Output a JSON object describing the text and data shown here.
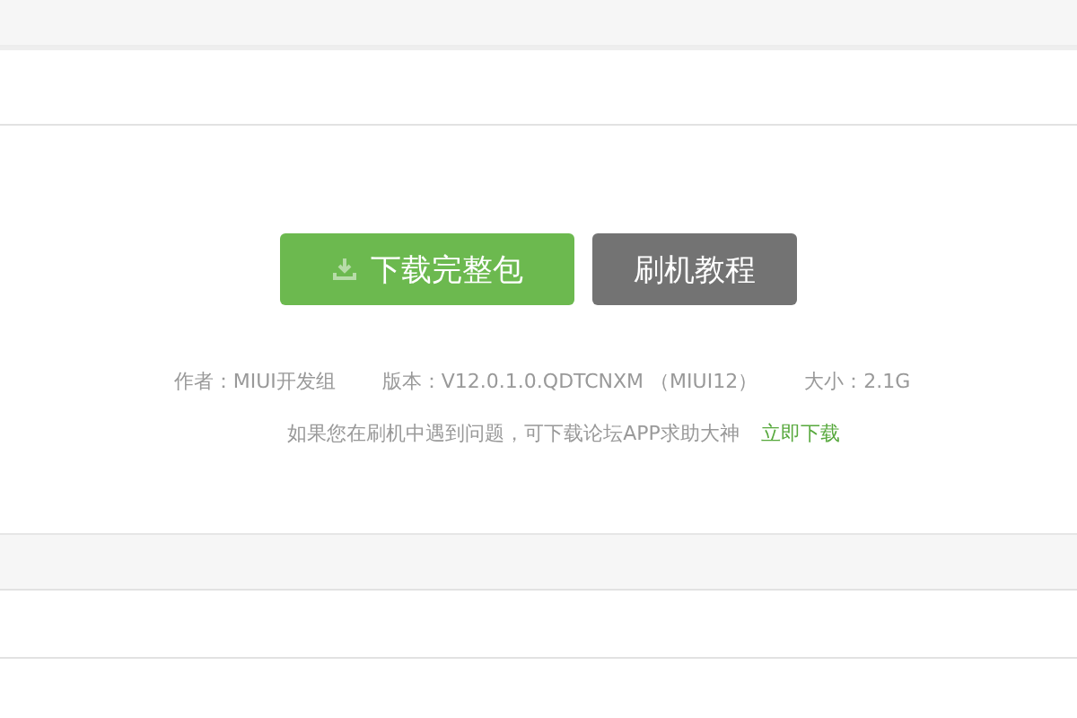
{
  "buttons": [
    {
      "kind": "download",
      "label": "下载完整包"
    },
    {
      "kind": "tutorial",
      "label": "刷机教程"
    }
  ],
  "meta": [
    "作者：MIUI开发组",
    "版本：V12.0.1.0.QDTCNXM （MIUI12）",
    "大小：2.1G"
  ],
  "help": {
    "text": "如果您在刷机中遇到问题，可下载论坛APP求助大神",
    "link": "立即下载"
  }
}
